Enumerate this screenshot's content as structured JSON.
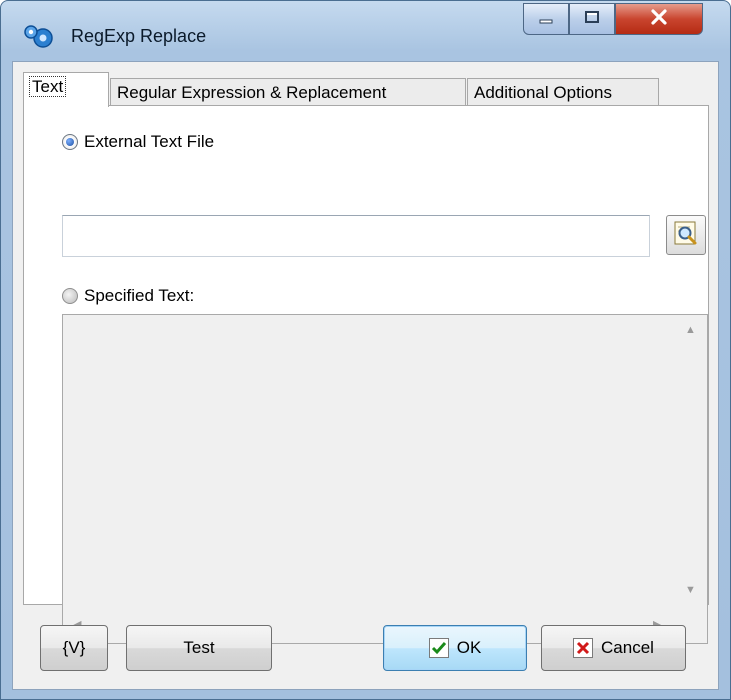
{
  "window": {
    "title": "RegExp Replace",
    "icon": "regexp-gears-icon",
    "caption_buttons": [
      "minimize-icon",
      "maximize-icon",
      "close-icon"
    ]
  },
  "tabs": [
    {
      "label": "Text",
      "active": true
    },
    {
      "label": "Regular Expression & Replacement",
      "active": false
    },
    {
      "label": "Additional Options",
      "active": false
    }
  ],
  "text_tab": {
    "external_file": {
      "label": "External Text File",
      "selected": true,
      "value": "",
      "browse_icon": "browse-magnifier-icon"
    },
    "specified_text": {
      "label": "Specified Text:",
      "selected": false,
      "value": ""
    }
  },
  "buttons": {
    "variables": "{V}",
    "test": "Test",
    "ok": "OK",
    "cancel": "Cancel"
  },
  "colors": {
    "title_bar": "#b5cde6",
    "close_button": "#c9452f",
    "ok_check": "#1a8a1a",
    "cancel_x": "#d11a1a"
  }
}
